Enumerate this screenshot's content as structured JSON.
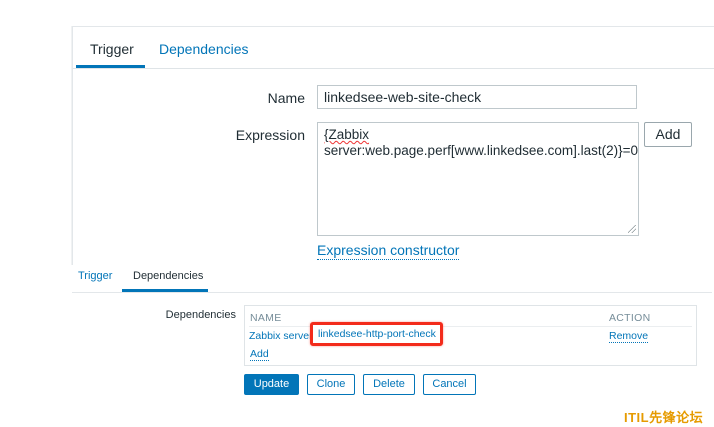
{
  "top_form": {
    "tabs": [
      "Trigger",
      "Dependencies"
    ],
    "name_label": "Name",
    "name_value": "linkedsee-web-site-check",
    "expression_label": "Expression",
    "expression_line1": "{Zabbix",
    "expression_line2": "server:web.page.perf[www.linkedsee.com].last(2)}=0",
    "add_button": "Add",
    "expression_constructor_link": "Expression constructor"
  },
  "bottom_form": {
    "tabs": [
      "Trigger",
      "Dependencies"
    ],
    "dependencies_label": "Dependencies",
    "table_headers": {
      "name": "NAME",
      "action": "ACTION"
    },
    "dependency_name": "Zabbix server: linkedsee-http-port-check",
    "dependency_highlighted_text": "linkedsee-http-port-check",
    "remove_link": "Remove",
    "add_link": "Add",
    "buttons": {
      "update": "Update",
      "clone": "Clone",
      "delete": "Delete",
      "cancel": "Cancel"
    }
  },
  "watermark": "ITIL先锋论坛",
  "colors": {
    "link": "#0275b8",
    "highlight_border": "#f32b1b",
    "watermark": "#e69b00"
  }
}
